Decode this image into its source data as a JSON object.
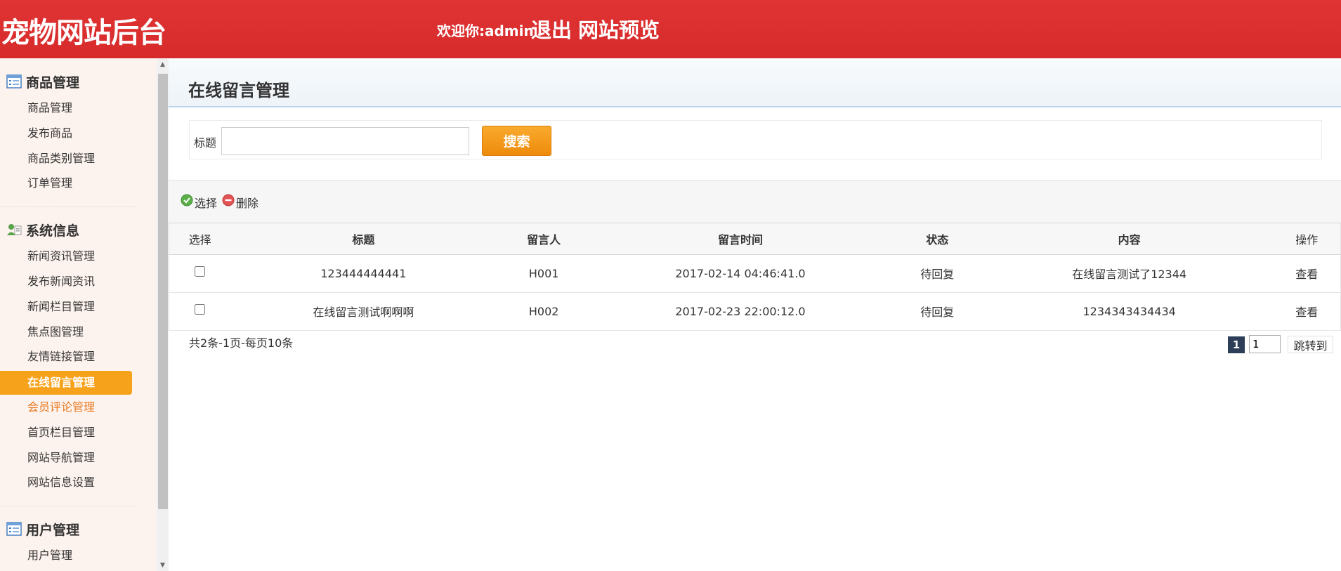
{
  "header": {
    "site_title": "宠物网站后台",
    "welcome": "欢迎你:admin",
    "logout": "退出",
    "preview": "网站预览"
  },
  "sidebar": {
    "groups": [
      {
        "title": "商品管理",
        "icon": "list-icon",
        "items": [
          {
            "label": "商品管理"
          },
          {
            "label": "发布商品"
          },
          {
            "label": "商品类别管理"
          },
          {
            "label": "订单管理"
          }
        ]
      },
      {
        "title": "系统信息",
        "icon": "users-icon",
        "items": [
          {
            "label": "新闻资讯管理"
          },
          {
            "label": "发布新闻资讯"
          },
          {
            "label": "新闻栏目管理"
          },
          {
            "label": "焦点图管理"
          },
          {
            "label": "友情链接管理"
          },
          {
            "label": "在线留言管理",
            "active": true
          },
          {
            "label": "会员评论管理"
          },
          {
            "label": "首页栏目管理"
          },
          {
            "label": "网站导航管理"
          },
          {
            "label": "网站信息设置"
          }
        ]
      },
      {
        "title": "用户管理",
        "icon": "list-icon",
        "items": [
          {
            "label": "用户管理"
          }
        ]
      }
    ]
  },
  "main": {
    "page_title": "在线留言管理",
    "search": {
      "label": "标题",
      "value": "",
      "placeholder": "",
      "button": "搜索"
    },
    "toolbar": {
      "select_label": "选择",
      "delete_label": "删除"
    },
    "table": {
      "headers": [
        "选择",
        "标题",
        "留言人",
        "留言时间",
        "状态",
        "内容",
        "操作"
      ],
      "rows": [
        {
          "title": "123444444441",
          "author": "H001",
          "time": "2017-02-14 04:46:41.0",
          "status": "待回复",
          "content": "在线留言测试了12344",
          "action": "查看"
        },
        {
          "title": "在线留言测试啊啊啊",
          "author": "H002",
          "time": "2017-02-23 22:00:12.0",
          "status": "待回复",
          "content": "1234343434434",
          "action": "查看"
        }
      ]
    },
    "pager": {
      "info": "共2条-1页-每页10条",
      "current": "1",
      "input_value": "1",
      "jump_label": "跳转到"
    }
  },
  "colors": {
    "header_red": "#d72a2a",
    "active_orange": "#f7a21b",
    "search_orange": "#ee8b0b",
    "pager_dark": "#2c3e58"
  }
}
